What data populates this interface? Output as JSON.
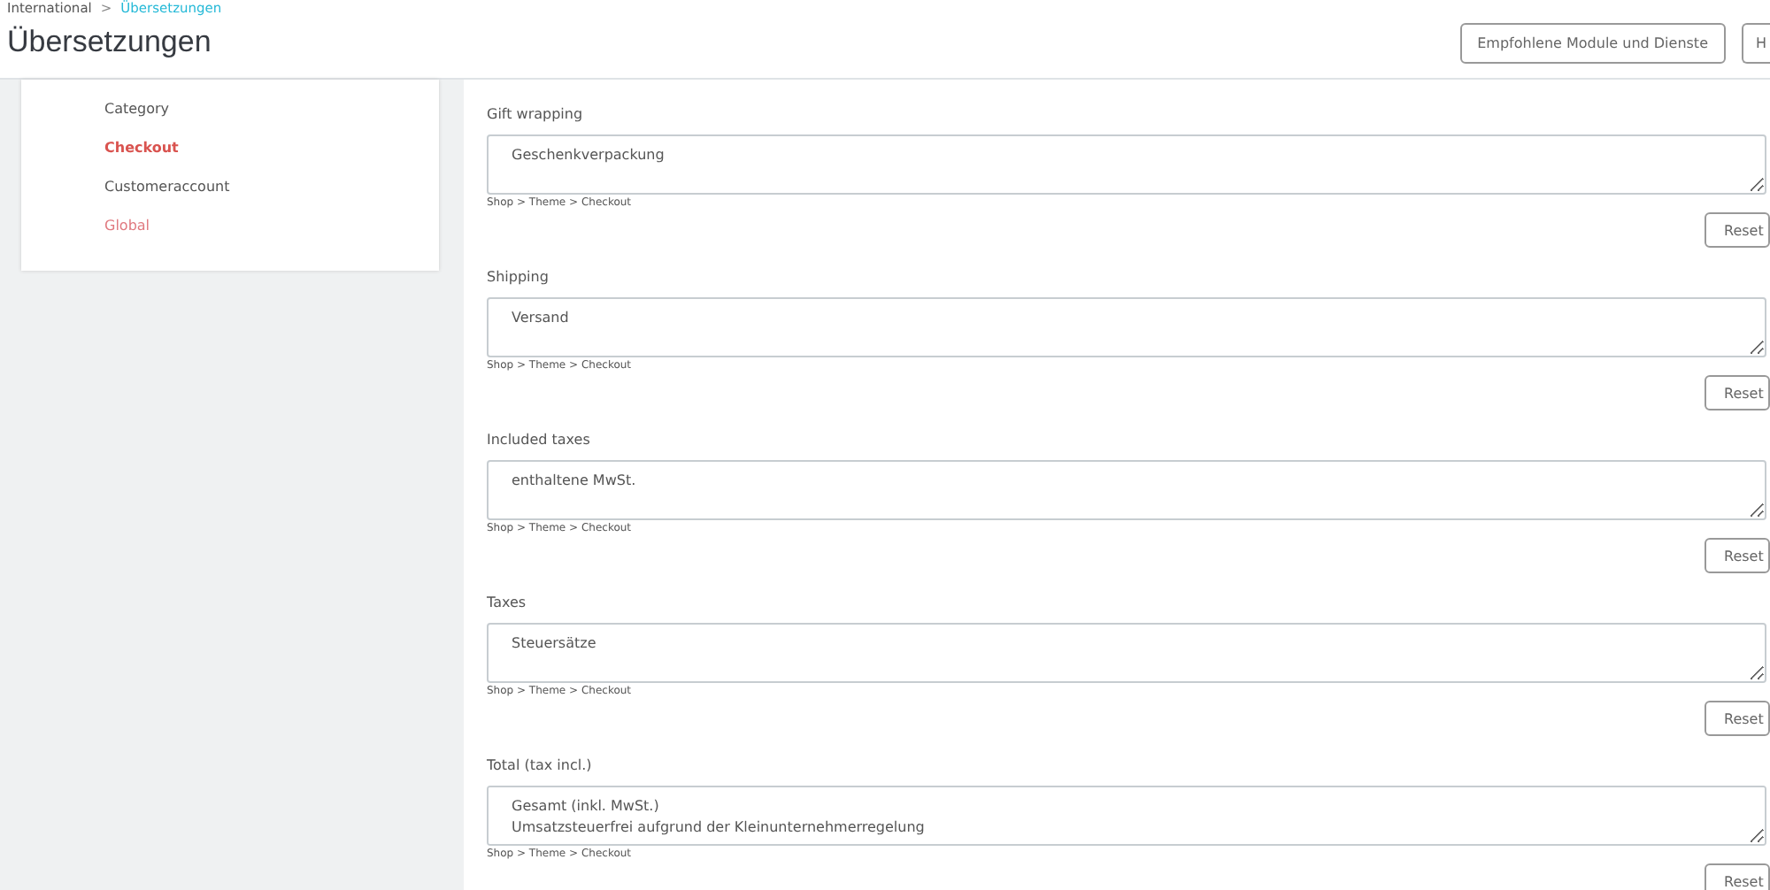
{
  "breadcrumb": [
    {
      "label": "International",
      "current": false
    },
    {
      "label": "Übersetzungen",
      "current": true
    }
  ],
  "breadcrumb_separator": ">",
  "page_title": "Übersetzungen",
  "header_buttons": [
    "Empfohlene Module und Dienste",
    "H"
  ],
  "sidebar": {
    "items": [
      {
        "label": "Category",
        "selected": false,
        "color": "#555555"
      },
      {
        "label": "Checkout",
        "selected": true,
        "color": "#d9534f"
      },
      {
        "label": "Customeraccount",
        "selected": false,
        "color": "#555555"
      },
      {
        "label": "Global",
        "selected": false,
        "color": "#e07a80"
      }
    ]
  },
  "translations": [
    {
      "label": "Gift wrapping",
      "value": "Geschenkverpackung",
      "path": "Shop > Theme > Checkout",
      "button": "Reset"
    },
    {
      "label": "Shipping",
      "value": "Versand",
      "path": "Shop > Theme > Checkout",
      "button": "Reset"
    },
    {
      "label": "Included taxes",
      "value": "enthaltene MwSt.",
      "path": "Shop > Theme > Checkout",
      "button": "Reset"
    },
    {
      "label": "Taxes",
      "value": "Steuersätze",
      "path": "Shop > Theme > Checkout",
      "button": "Reset"
    },
    {
      "label": "Total (tax incl.)",
      "value": "Gesamt (inkl. MwSt.)\nUmsatzsteuerfrei aufgrund der Kleinunternehmerregelung",
      "path": "Shop > Theme > Checkout",
      "button": "Reset"
    }
  ]
}
